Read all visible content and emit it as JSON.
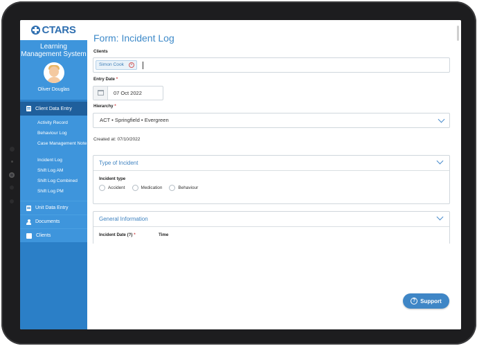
{
  "app": {
    "logo_text": "CTARS",
    "system_title": "Learning Management System",
    "user_name": "Oliver Douglas"
  },
  "sidebar": {
    "sections": [
      {
        "label": "Client Data Entry",
        "icon": "document-icon",
        "active": true
      },
      {
        "label": "Unit Data Entry",
        "icon": "document-icon",
        "active": false
      },
      {
        "label": "Documents",
        "icon": "person-icon",
        "active": false
      },
      {
        "label": "Clients",
        "icon": "cards-icon",
        "active": false
      }
    ],
    "sub_items": [
      {
        "label": "Activity Record"
      },
      {
        "label": "Behaviour Log"
      },
      {
        "label": "Case Management Note"
      },
      {
        "label": "Incident Log"
      },
      {
        "label": "Shift Log AM"
      },
      {
        "label": "Shift Log Combined"
      },
      {
        "label": "Shift Log PM"
      }
    ]
  },
  "form": {
    "title": "Form: Incident Log",
    "clients_label": "Clients",
    "client_chip": "Simon Cook",
    "entry_date_label": "Entry Date",
    "entry_date_value": "07 Oct 2022",
    "hierarchy_label": "Hierarchy",
    "hierarchy_value": "ACT  •  Springfield  •  Evergreen",
    "created_at": "Created at: 07/10/2022",
    "required_mark": "*"
  },
  "panels": {
    "type_of_incident": {
      "title": "Type of Incident",
      "field_label": "Incident type",
      "options": [
        "Accident",
        "Medication",
        "Behaviour"
      ]
    },
    "general_information": {
      "title": "General Information",
      "incident_date_label": "Incident Date (?)",
      "time_label": "Time"
    }
  },
  "support": {
    "label": "Support"
  },
  "colors": {
    "sidebar": "#2b7fc7",
    "sidebar_light": "#3e95dc",
    "active_section": "#1f5f9c",
    "accent": "#3e8ac9",
    "support_button": "#3f86c6"
  }
}
